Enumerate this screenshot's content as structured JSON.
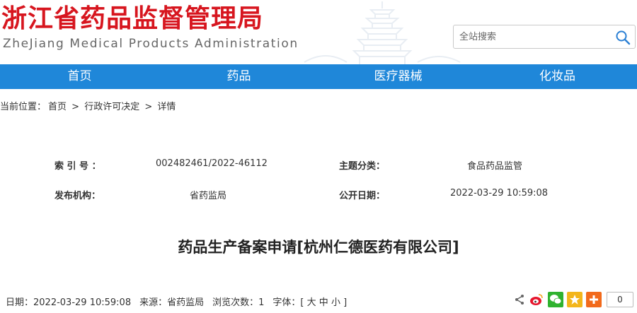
{
  "header": {
    "logo_cn": "浙江省药品监督管理局",
    "logo_en": "ZheJiang Medical Products Administration",
    "search_placeholder": "全站搜索"
  },
  "nav": {
    "items": [
      {
        "label": "首页"
      },
      {
        "label": "药品"
      },
      {
        "label": "医疗器械"
      },
      {
        "label": "化妆品"
      }
    ]
  },
  "breadcrumb": {
    "prefix": "当前位置：",
    "items": [
      "首页",
      "行政许可决定",
      "详情"
    ],
    "sep": ">"
  },
  "info": {
    "index_label": "索 引 号 ：",
    "index_value": "002482461/2022-46112",
    "topic_label": "主题分类：",
    "topic_value": "食品药品监管",
    "org_label": "发布机构：",
    "org_value": "省药监局",
    "date_label": "公开日期：",
    "date_value": "2022-03-29 10:59:08"
  },
  "article": {
    "title": "药品生产备案申请[杭州仁德医药有限公司]"
  },
  "meta": {
    "date_label": "日期：",
    "date_value": "2022-03-29 10:59:08",
    "source_label": "来源：",
    "source_value": "省药监局",
    "views_label": "浏览次数：",
    "views_value": "1",
    "font_label": "字体：[",
    "font_large": "大",
    "font_medium": "中",
    "font_small": "小",
    "font_end": "]"
  },
  "share": {
    "count": "0"
  },
  "colors": {
    "brand_red": "#d7161f",
    "nav_blue": "#1f87d9"
  }
}
